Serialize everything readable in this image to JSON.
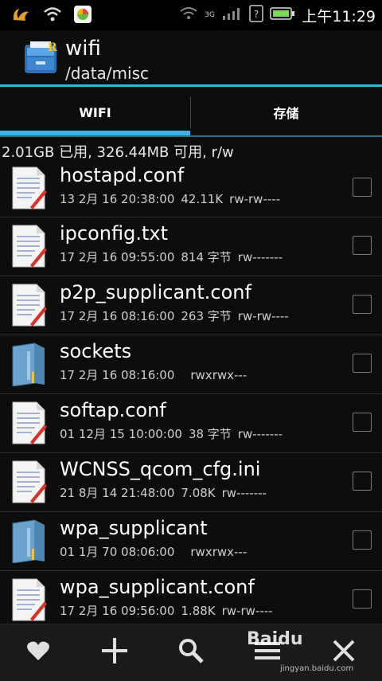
{
  "status": {
    "time": "上午11:29",
    "network": "3G",
    "question_icon": "question-icon",
    "battery_icon": "battery-icon"
  },
  "app": {
    "title": "wifi",
    "path": "/data/misc"
  },
  "tabs": [
    {
      "label": "WIFI",
      "selected": true
    },
    {
      "label": "存储",
      "selected": false
    }
  ],
  "storage": "2.01GB 已用, 326.44MB 可用, r/w",
  "files": [
    {
      "name": "hostapd.conf",
      "date": "13 2月 16 20:38:00",
      "size": "42.11K",
      "perm": "rw-rw----",
      "type": "file"
    },
    {
      "name": "ipconfig.txt",
      "date": "17 2月 16 09:55:00",
      "size": "814 字节",
      "perm": "rw-------",
      "type": "file"
    },
    {
      "name": "p2p_supplicant.conf",
      "date": "17 2月 16 08:16:00",
      "size": "263 字节",
      "perm": "rw-rw----",
      "type": "file"
    },
    {
      "name": "sockets",
      "date": "17 2月 16 08:16:00",
      "size": "",
      "perm": "rwxrwx---",
      "type": "folder"
    },
    {
      "name": "softap.conf",
      "date": "01 12月 15 10:00:00",
      "size": "38 字节",
      "perm": "rw-------",
      "type": "file"
    },
    {
      "name": "WCNSS_qcom_cfg.ini",
      "date": "21 8月 14 21:48:00",
      "size": "7.08K",
      "perm": "rw-------",
      "type": "file"
    },
    {
      "name": "wpa_supplicant",
      "date": "01 1月 70 08:06:00",
      "size": "",
      "perm": "rwxrwx---",
      "type": "folder"
    },
    {
      "name": "wpa_supplicant.conf",
      "date": "17 2月 16 09:56:00",
      "size": "1.88K",
      "perm": "rw-rw----",
      "type": "file"
    }
  ],
  "bottom_buttons": [
    "heart-icon",
    "plus-icon",
    "search-icon",
    "menu-icon",
    "close-icon"
  ],
  "watermark": {
    "text": "Baidu",
    "sub": "jingyan.baidu.com"
  },
  "colors": {
    "accent": "#33b5e5",
    "background": "#0d0d0d"
  }
}
